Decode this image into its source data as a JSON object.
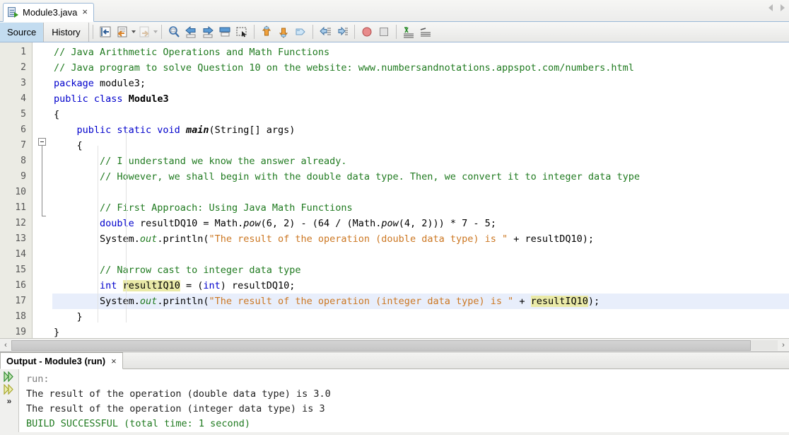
{
  "window": {
    "file_tab": {
      "label": "Module3.java",
      "icon": "java-file-icon",
      "close": "×"
    },
    "scroll_left": "◀",
    "scroll_right": "▶"
  },
  "toolbar": {
    "source_label": "Source",
    "history_label": "History",
    "buttons": [
      {
        "name": "last-edit-icon"
      },
      {
        "name": "back-history-icon"
      },
      {
        "name": "forward-history-icon"
      },
      {
        "name": "find-selection-icon"
      },
      {
        "name": "previous-bookmark-icon"
      },
      {
        "name": "next-bookmark-icon"
      },
      {
        "name": "toggle-bookmark-icon"
      },
      {
        "name": "select-rectangular-icon"
      },
      {
        "name": "previous-error-icon"
      },
      {
        "name": "next-error-icon"
      },
      {
        "name": "shift-line-left-icon"
      },
      {
        "name": "shift-line-right-icon"
      },
      {
        "name": "toggle-breakpoint-icon"
      },
      {
        "name": "stop-icon"
      },
      {
        "name": "comment-icon"
      },
      {
        "name": "uncomment-icon"
      }
    ]
  },
  "editor": {
    "line_numbers": [
      1,
      2,
      3,
      4,
      5,
      6,
      7,
      8,
      9,
      10,
      11,
      12,
      13,
      14,
      15,
      16,
      17,
      18,
      19
    ],
    "current_line": 17,
    "fold_marker_line": 7,
    "lines": [
      {
        "n": 1,
        "text": "// Java Arithmetic Operations and Math Functions"
      },
      {
        "n": 2,
        "text": "// Java program to solve Question 10 on the website: www.numbersandnotations.appspot.com/numbers.html"
      },
      {
        "n": 3,
        "text": "package module3;"
      },
      {
        "n": 4,
        "text": "public class Module3"
      },
      {
        "n": 5,
        "text": "{"
      },
      {
        "n": 6,
        "text": "    public static void main(String[] args)"
      },
      {
        "n": 7,
        "text": "    {"
      },
      {
        "n": 8,
        "text": "        // I understand we know the answer already."
      },
      {
        "n": 9,
        "text": "        // However, we shall begin with the double data type. Then, we convert it to integer data type"
      },
      {
        "n": 10,
        "text": ""
      },
      {
        "n": 11,
        "text": "        // First Approach: Using Java Math Functions"
      },
      {
        "n": 12,
        "text": "        double resultDQ10 = Math.pow(6, 2) - (64 / (Math.pow(4, 2))) * 7 - 5;"
      },
      {
        "n": 13,
        "text": "        System.out.println(\"The result of the operation (double data type) is \" + resultDQ10);"
      },
      {
        "n": 14,
        "text": ""
      },
      {
        "n": 15,
        "text": "        // Narrow cast to integer data type"
      },
      {
        "n": 16,
        "text": "        int resultIQ10 = (int) resultDQ10;"
      },
      {
        "n": 17,
        "text": "        System.out.println(\"The result of the operation (integer data type) is \" + resultIQ10);"
      },
      {
        "n": 18,
        "text": "    }"
      },
      {
        "n": 19,
        "text": "}"
      }
    ],
    "highlighted_identifier": "resultIQ10",
    "scrollbar": {
      "left_arrow": "‹",
      "right_arrow": "›"
    }
  },
  "output": {
    "tab_label": "Output - Module3 (run)",
    "tab_close": "×",
    "side_icons": [
      {
        "name": "rerun-icon"
      },
      {
        "name": "rerun-alt-icon"
      },
      {
        "name": "more-actions-icon",
        "glyph": "»"
      }
    ],
    "lines": [
      {
        "text": "run:",
        "style": "muted"
      },
      {
        "text": "The result of the operation (double data type) is 3.0",
        "style": "plain"
      },
      {
        "text": "The result of the operation (integer data type) is 3",
        "style": "plain"
      },
      {
        "text": "BUILD SUCCESSFUL (total time: 1 second)",
        "style": "ok"
      }
    ]
  },
  "colors": {
    "comment": "#1f7a1f",
    "keyword": "#0000cc",
    "string": "#cc7722",
    "highlight": "#eaeaa8",
    "current_line": "#e8eefb",
    "tab_accent": "#9ab8d6",
    "source_tab_bg": "#c3dcf0"
  }
}
